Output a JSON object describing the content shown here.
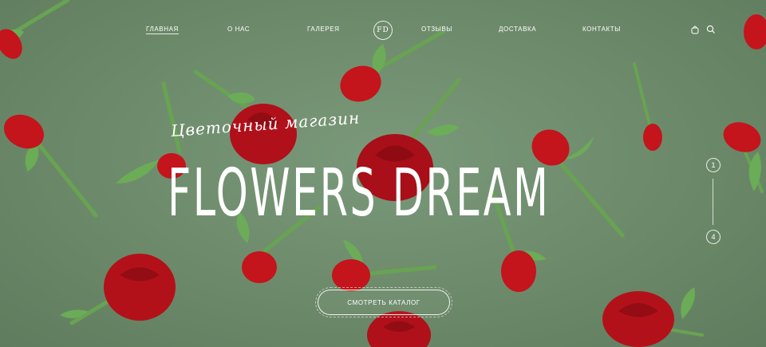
{
  "nav": {
    "items": [
      {
        "label": "ГЛАВНАЯ",
        "active": true
      },
      {
        "label": "О НАС",
        "active": false
      },
      {
        "label": "ГАЛЕРЕЯ",
        "active": false
      },
      {
        "label": "ОТЗЫВЫ",
        "active": false
      },
      {
        "label": "ДОСТАВКА",
        "active": false
      },
      {
        "label": "КОНТАКТЫ",
        "active": false
      }
    ],
    "logo": "FD",
    "icons": [
      "cart-icon",
      "search-icon"
    ]
  },
  "hero": {
    "script_text": "Цветочный магазин",
    "title": "FLOWERS DREAM",
    "cta_label": "СМОТРЕТЬ КАТАЛОГ"
  },
  "pager": {
    "current": "1",
    "total": "4"
  },
  "colors": {
    "background": "#6e8c6c",
    "rose": "#c4141c",
    "stem": "#5f9a4e",
    "text": "#ffffff"
  }
}
